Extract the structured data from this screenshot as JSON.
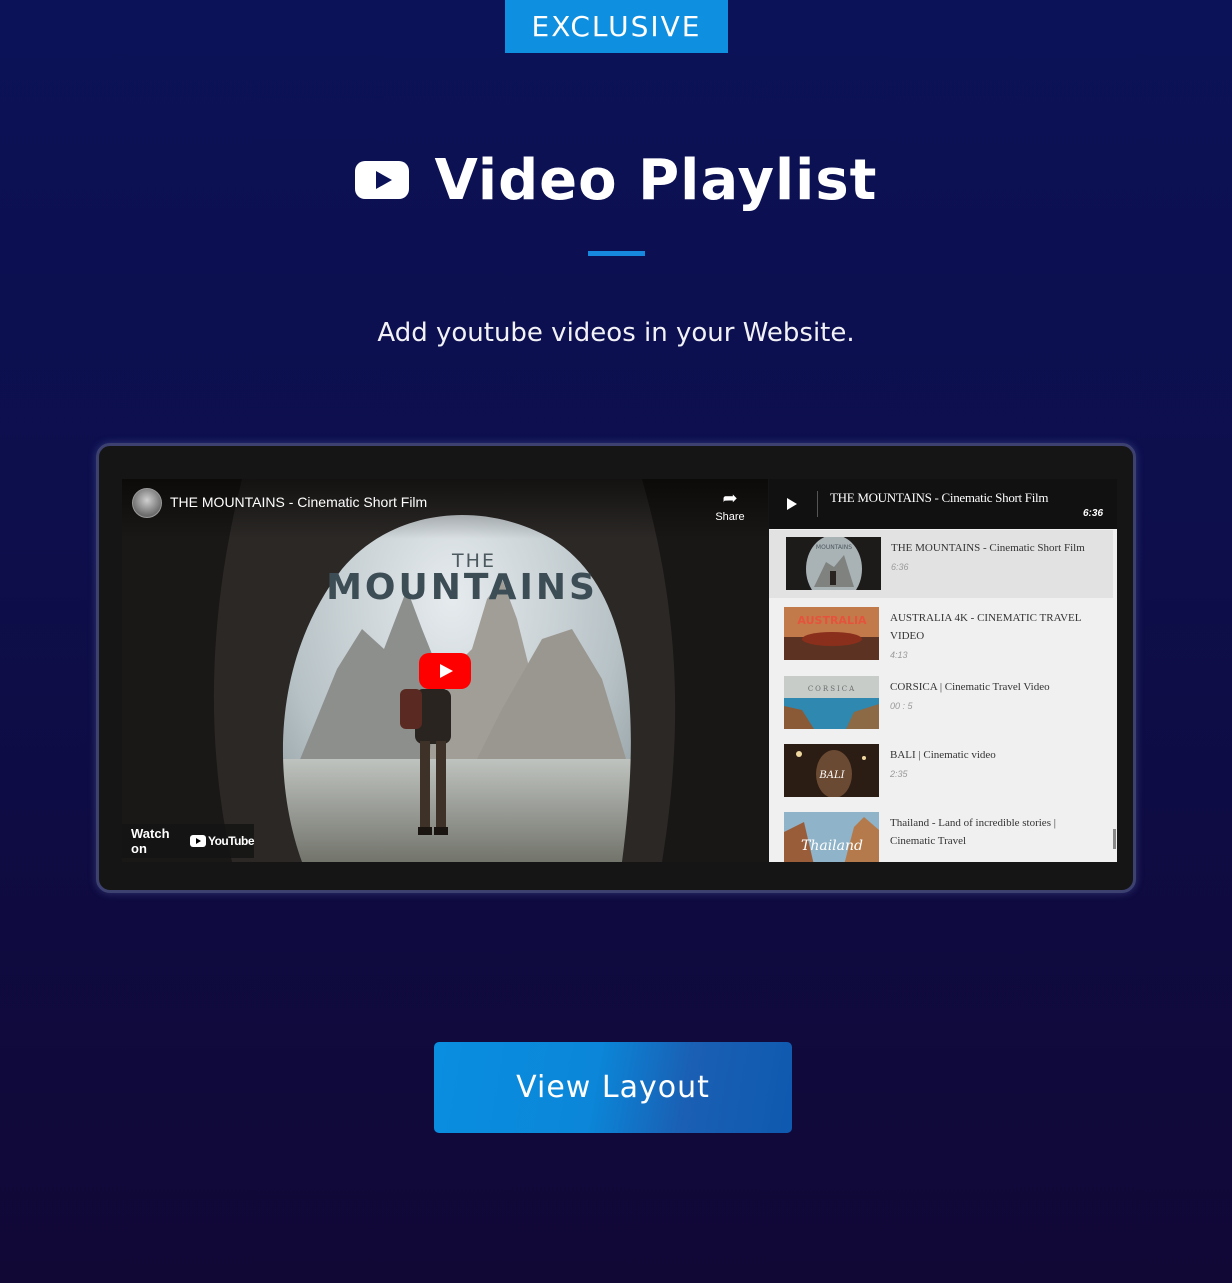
{
  "badge": "EXCLUSIVE",
  "header": {
    "title": "Video Playlist",
    "subtitle": "Add youtube videos in your Website."
  },
  "player": {
    "video_title": "THE MOUNTAINS - Cinematic Short Film",
    "share_label": "Share",
    "watch_on_label": "Watch on",
    "youtube_word": "YouTube",
    "thumb_text_line1": "THE",
    "thumb_text_line2": "MOUNTAINS"
  },
  "playlist": {
    "now_playing_title": "THE MOUNTAINS - Cinematic Short Film",
    "now_playing_duration": "6:36",
    "items": [
      {
        "title": "THE MOUNTAINS - Cinematic Short Film",
        "duration": "6:36",
        "thumb_label": "MOUNTAINS"
      },
      {
        "title": "AUSTRALIA 4K - CINEMATIC TRAVEL VIDEO",
        "duration": "4:13",
        "thumb_label": "AUSTRALIA"
      },
      {
        "title": "CORSICA | Cinematic Travel Video",
        "duration": "00 : 5",
        "thumb_label": "CORSICA"
      },
      {
        "title": "BALI | Cinematic video",
        "duration": "2:35",
        "thumb_label": "BALI"
      },
      {
        "title": "Thailand - Land of incredible stories | Cinematic Travel",
        "duration": "",
        "thumb_label": "Thailand"
      }
    ]
  },
  "cta": {
    "label": "View Layout"
  },
  "colors": {
    "accent": "#0e8fe0",
    "background": "#0c1258",
    "youtube_red": "#ff0000"
  }
}
